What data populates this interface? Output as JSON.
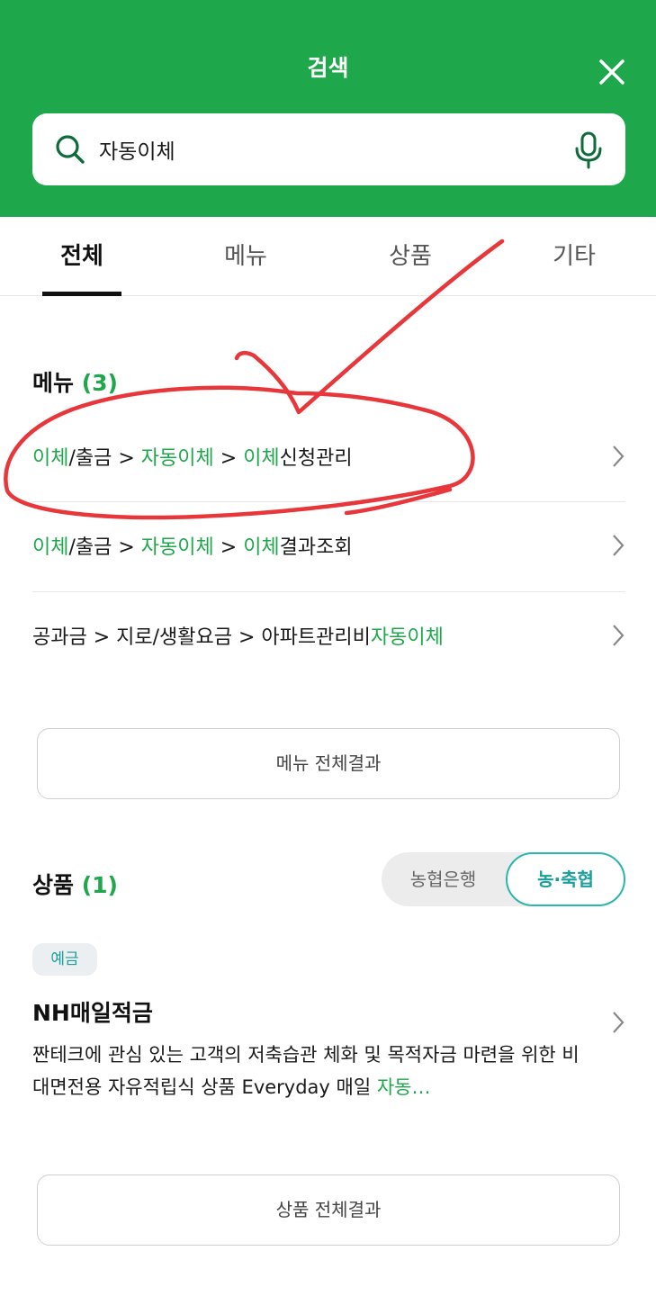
{
  "header": {
    "title": "검색",
    "close_icon": "close-icon"
  },
  "search": {
    "value": "자동이체",
    "search_icon": "search-icon",
    "mic_icon": "microphone-icon"
  },
  "tabs": [
    {
      "label": "전체",
      "active": true
    },
    {
      "label": "메뉴",
      "active": false
    },
    {
      "label": "상품",
      "active": false
    },
    {
      "label": "기타",
      "active": false
    }
  ],
  "menu_section": {
    "title": "메뉴",
    "count": "(3)",
    "items": [
      {
        "parts": [
          [
            "이체",
            true
          ],
          [
            "/출금 > ",
            false
          ],
          [
            "자동이체",
            true
          ],
          [
            " > ",
            false
          ],
          [
            "이체",
            true
          ],
          [
            "신청관리",
            false
          ]
        ]
      },
      {
        "parts": [
          [
            "이체",
            true
          ],
          [
            "/출금 > ",
            false
          ],
          [
            "자동이체",
            true
          ],
          [
            " > ",
            false
          ],
          [
            "이체",
            true
          ],
          [
            "결과조회",
            false
          ]
        ]
      },
      {
        "parts": [
          [
            "공과금 > 지로/생활요금 > 아파트관리비",
            false
          ],
          [
            "자동이체",
            true
          ]
        ]
      }
    ],
    "all_results_label": "메뉴 전체결과"
  },
  "product_section": {
    "title": "상품",
    "count": "(1)",
    "toggle": {
      "option1": "농협은행",
      "option2": "농·축협",
      "selected": "농·축협"
    },
    "product": {
      "badge": "예금",
      "name": "NH매일적금",
      "desc_plain": "짠테크에 관심 있는 고객의 저축습관 체화 및 목적자금 마련을 위한 비대면전용 자유적립식 상품 Everyday 매일 ",
      "desc_highlight": "자동…"
    },
    "all_results_label": "상품 전체결과"
  },
  "colors": {
    "brand_green": "#1ea84b",
    "teal": "#1a9f9a",
    "annotation_red": "#e8373b"
  }
}
